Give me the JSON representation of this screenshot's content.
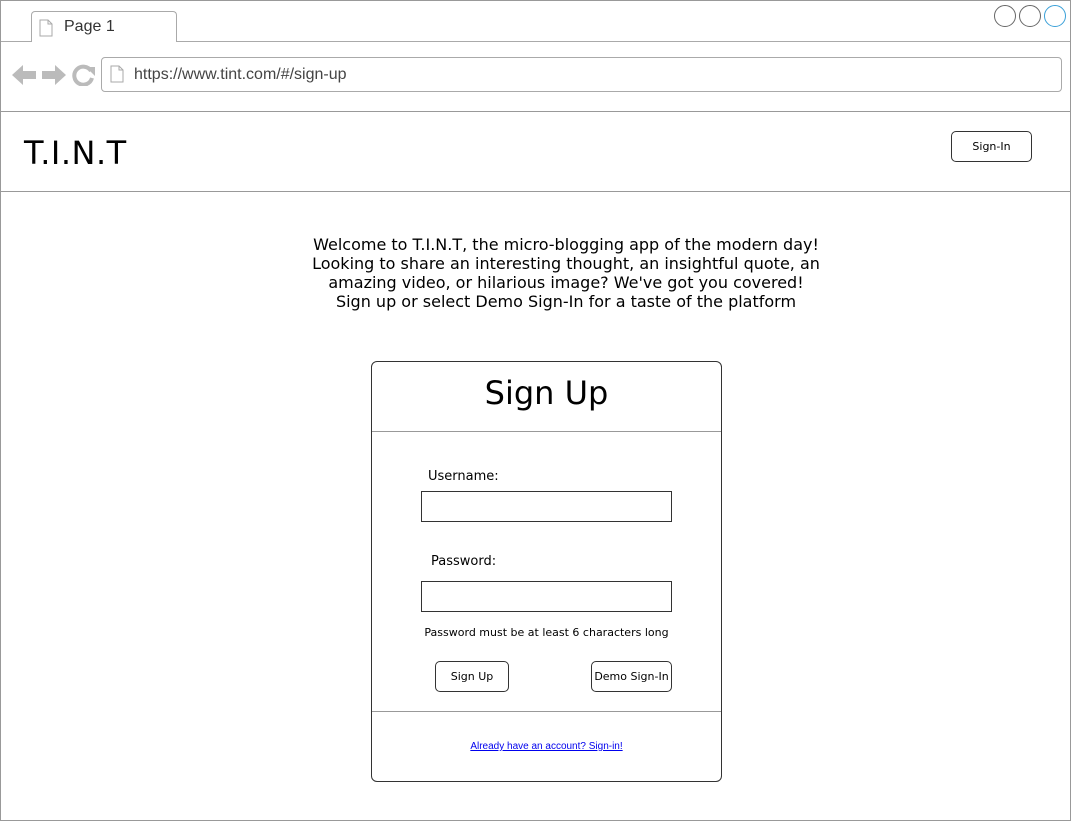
{
  "browser": {
    "tab_title": "Page 1",
    "url": "https://www.tint.com/#/sign-up"
  },
  "header": {
    "logo": "T.I.N.T",
    "signin_label": "Sign-In"
  },
  "welcome": {
    "lines": [
      "Welcome to T.I.N.T, the micro-blogging app of the modern day!",
      "Looking to share an interesting thought, an insightful quote, an",
      "amazing video, or hilarious image? We've got you covered!",
      "Sign up or select Demo Sign-In for a taste of the platform"
    ]
  },
  "form": {
    "title": "Sign Up",
    "username_label": "Username:",
    "username_value": "",
    "password_label": "Password:",
    "password_value": "",
    "password_hint": "Password must be at least 6 characters long",
    "signup_label": "Sign Up",
    "demo_label": "Demo Sign-In",
    "signin_link": "Already have an account? Sign-in!"
  },
  "icons": {
    "back": "arrow-left-icon",
    "forward": "arrow-right-icon",
    "reload": "reload-icon",
    "page": "page-icon"
  },
  "colors": {
    "link": "#0000ee",
    "active_window_control": "#3aa0d8"
  }
}
